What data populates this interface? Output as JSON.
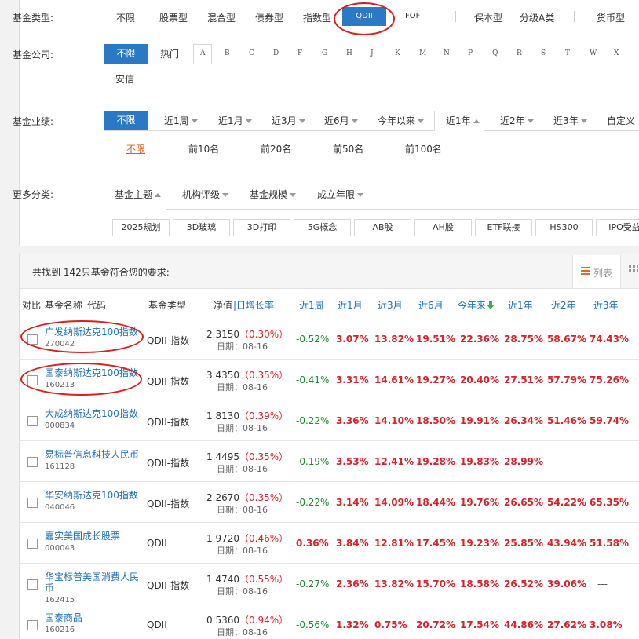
{
  "fund_type": {
    "label": "基金类型:",
    "options": [
      "不限",
      "股票型",
      "混合型",
      "债券型",
      "指数型",
      "QDII",
      "FOF",
      "保本型",
      "分级A类",
      "货币型"
    ]
  },
  "company": {
    "label": "基金公司:",
    "options": [
      "不限",
      "热门"
    ],
    "letters": [
      "A",
      "B",
      "C",
      "D",
      "F",
      "G",
      "H",
      "J",
      "K",
      "M",
      "N",
      "P",
      "Q",
      "R",
      "S",
      "T",
      "W",
      "X"
    ],
    "sub_option": "安信"
  },
  "performance": {
    "label": "基金业绩:",
    "options": [
      "不限",
      "近1周",
      "近1月",
      "近3月",
      "近6月",
      "今年以来",
      "近1年",
      "近2年",
      "近3年",
      "自定义"
    ],
    "rank_options": [
      "不限",
      "前10名",
      "前20名",
      "前50名",
      "前100名"
    ]
  },
  "more": {
    "label": "更多分类:",
    "tabs": [
      "基金主题",
      "机构评级",
      "基金规模",
      "成立年限"
    ],
    "tags": [
      "2025规划",
      "3D玻璃",
      "3D打印",
      "5G概念",
      "AB股",
      "AH股",
      "ETF联接",
      "HS300",
      "IPO受益"
    ]
  },
  "results": {
    "summary": "共找到 142只基金符合您的要求:",
    "list_view": "列表",
    "headers": [
      "对比",
      "基金名称",
      "代码",
      "基金类型",
      "净值",
      "日增长率",
      "近1周",
      "近1月",
      "近3月",
      "近6月",
      "今年来",
      "近1年",
      "近2年",
      "近3年"
    ],
    "rows": [
      {
        "name": "广发纳斯达克100指数",
        "code": "270042",
        "type": "QDII-指数",
        "nav": "2.3150",
        "change": "（0.30%）",
        "date": "日期：08-16",
        "w1": "-0.52%",
        "m1": "3.07%",
        "m3": "13.82%",
        "m6": "19.51%",
        "ytd": "22.36%",
        "y1": "28.75%",
        "y2": "58.67%",
        "y3": "74.43%"
      },
      {
        "name": "国泰纳斯达克100指数",
        "code": "160213",
        "type": "QDII-指数",
        "nav": "3.4350",
        "change": "（0.35%）",
        "date": "日期：08-16",
        "w1": "-0.41%",
        "m1": "3.31%",
        "m3": "14.61%",
        "m6": "19.27%",
        "ytd": "20.40%",
        "y1": "27.51%",
        "y2": "57.79%",
        "y3": "75.26%"
      },
      {
        "name": "大成纳斯达克100指数",
        "code": "000834",
        "type": "QDII-指数",
        "nav": "1.8130",
        "change": "（0.39%）",
        "date": "日期：08-16",
        "w1": "-0.22%",
        "m1": "3.36%",
        "m3": "14.10%",
        "m6": "18.50%",
        "ytd": "19.91%",
        "y1": "26.34%",
        "y2": "51.46%",
        "y3": "59.74%"
      },
      {
        "name": "易标普信息科技人民币",
        "code": "161128",
        "type": "QDII-指数",
        "nav": "1.4495",
        "change": "（0.35%）",
        "date": "日期：08-16",
        "w1": "-0.19%",
        "m1": "3.53%",
        "m3": "12.41%",
        "m6": "19.28%",
        "ytd": "19.83%",
        "y1": "28.99%",
        "y2": "---",
        "y3": "---"
      },
      {
        "name": "华安纳斯达克100指数",
        "code": "040046",
        "type": "QDII-指数",
        "nav": "2.2670",
        "change": "（0.35%）",
        "date": "日期：08-16",
        "w1": "-0.22%",
        "m1": "3.14%",
        "m3": "14.09%",
        "m6": "18.44%",
        "ytd": "19.76%",
        "y1": "26.65%",
        "y2": "54.22%",
        "y3": "65.35%"
      },
      {
        "name": "嘉实美国成长股票",
        "code": "000043",
        "type": "QDII",
        "nav": "1.9720",
        "change": "（0.46%）",
        "date": "日期：08-16",
        "w1": "0.36%",
        "m1": "3.84%",
        "m3": "12.81%",
        "m6": "17.45%",
        "ytd": "19.23%",
        "y1": "25.85%",
        "y2": "43.94%",
        "y3": "51.58%"
      },
      {
        "name": "华宝标普美国消费人民币",
        "code": "162415",
        "type": "QDII-指数",
        "nav": "1.4740",
        "change": "（0.55%）",
        "date": "日期：08-16",
        "w1": "-0.27%",
        "m1": "2.36%",
        "m3": "13.82%",
        "m6": "15.70%",
        "ytd": "18.58%",
        "y1": "26.52%",
        "y2": "39.06%",
        "y3": "---"
      },
      {
        "name": "国泰商品",
        "code": "160216",
        "type": "QDII",
        "nav": "0.5360",
        "change": "（0.94%）",
        "date": "日期：08-16",
        "w1": "-0.56%",
        "m1": "1.32%",
        "m3": "0.75%",
        "m6": "20.72%",
        "ytd": "17.54%",
        "y1": "44.86%",
        "y2": "27.62%",
        "y3": "3.08%"
      }
    ]
  },
  "colors": {
    "accent": "#2a79c4",
    "link": "#1c6fb6",
    "up": "#d4232b",
    "down": "#1b8a2e",
    "highlight": "#d9201b"
  },
  "icons": [
    "list-icon",
    "grid-icon",
    "checkbox-icon",
    "sort-down-icon",
    "caret-down-icon",
    "caret-up-icon"
  ]
}
